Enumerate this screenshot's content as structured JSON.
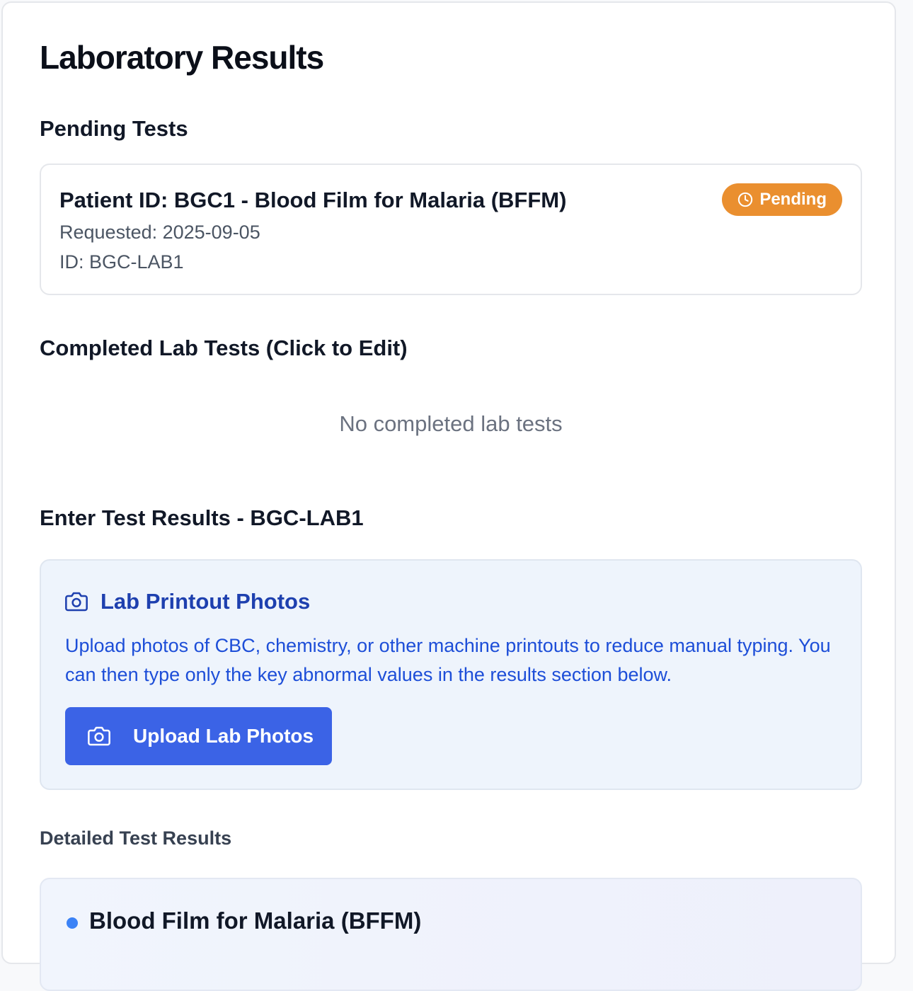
{
  "page": {
    "title": "Laboratory Results"
  },
  "pending": {
    "heading": "Pending Tests",
    "card": {
      "title": "Patient ID: BGC1 - Blood Film for Malaria (BFFM)",
      "requested": "Requested: 2025-09-05",
      "id_line": "ID: BGC-LAB1",
      "badge": "Pending",
      "badge_icon": "clock-icon",
      "badge_color": "#ea8f2f"
    }
  },
  "completed": {
    "heading": "Completed Lab Tests (Click to Edit)",
    "empty_text": "No completed lab tests"
  },
  "enter_results": {
    "heading": "Enter Test Results - BGC-LAB1",
    "photos": {
      "icon": "camera-icon",
      "title": "Lab Printout Photos",
      "description": "Upload photos of CBC, chemistry, or other machine printouts to reduce manual typing. You can then type only the key abnormal values in the results section below.",
      "button_label": "Upload Lab Photos",
      "button_color": "#3b63e6"
    },
    "detailed_label": "Detailed Test Results",
    "tests": [
      {
        "name": "Blood Film for Malaria (BFFM)",
        "dot_color": "#3b82f6"
      }
    ]
  }
}
